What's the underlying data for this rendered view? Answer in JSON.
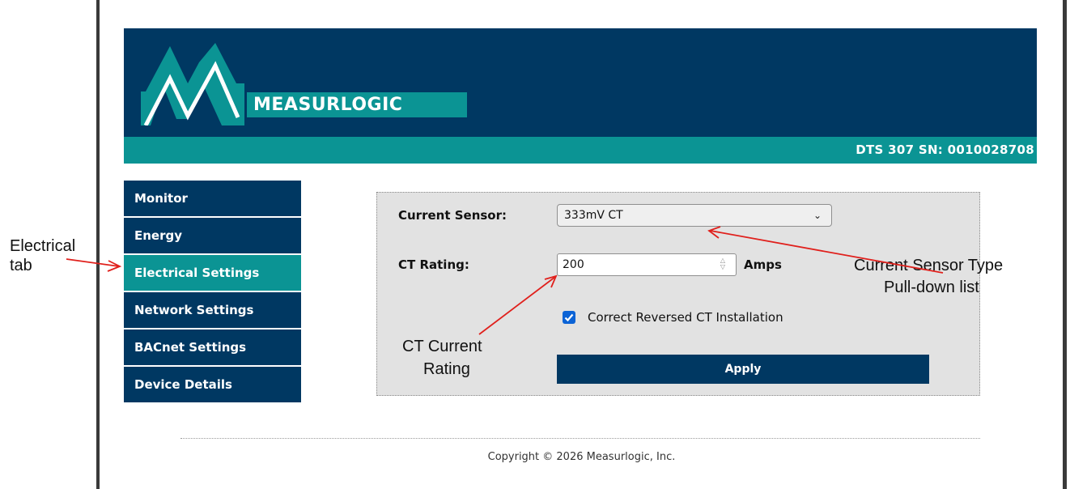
{
  "header": {
    "brand": "MEASURLOGIC",
    "device_serial": "DTS 307 SN: 0010028708"
  },
  "nav": {
    "items": [
      {
        "label": "Monitor"
      },
      {
        "label": "Energy"
      },
      {
        "label": "Electrical Settings",
        "active": true
      },
      {
        "label": "Network Settings"
      },
      {
        "label": "BACnet Settings"
      },
      {
        "label": "Device Details"
      }
    ]
  },
  "form": {
    "sensor_label": "Current Sensor:",
    "sensor_value": "333mV CT",
    "rating_label": "CT Rating:",
    "rating_value": "200",
    "rating_unit": "Amps",
    "reversed_label": "Correct Reversed CT Installation",
    "reversed_checked": true,
    "apply_label": "Apply"
  },
  "footer": {
    "copyright": "Copyright © 2026 Measurlogic, Inc."
  },
  "annotations": {
    "electrical_tab_line1": "Electrical",
    "electrical_tab_line2": "tab",
    "sensor_type_line1": "Current Sensor Type",
    "sensor_type_line2": "Pull-down list",
    "ct_rating_line1": "CT Current",
    "ct_rating_line2": "Rating"
  },
  "colors": {
    "navy": "#003862",
    "teal": "#0b9494",
    "annotation_arrow": "#e0201c",
    "checkbox": "#0b63d6"
  }
}
